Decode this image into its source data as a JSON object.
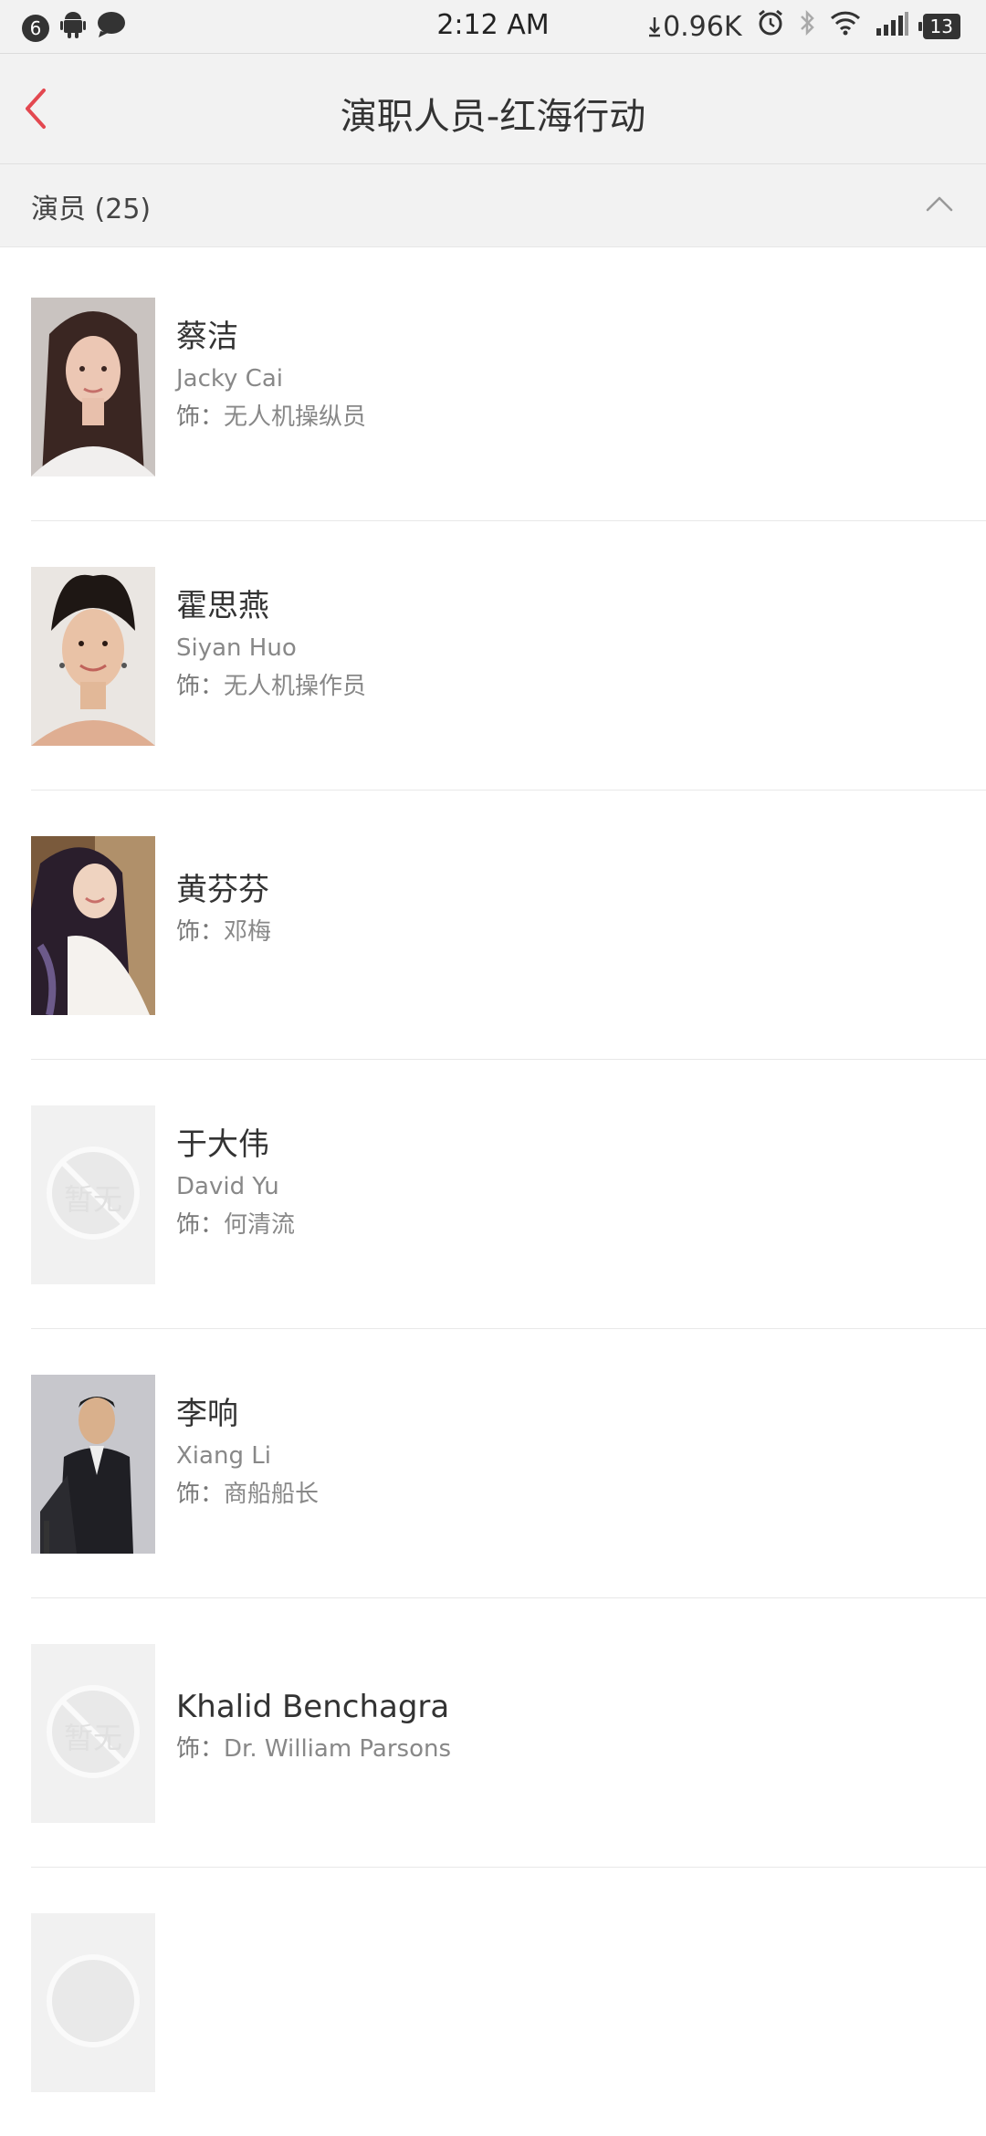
{
  "status_bar": {
    "notification_count": "6",
    "time": "2:12 AM",
    "network_speed": "0.96K",
    "battery": "13",
    "icons": [
      "android-icon",
      "chat-icon",
      "download-arrow-icon",
      "alarm-icon",
      "bluetooth-icon",
      "wifi-icon",
      "signal-icon",
      "battery-icon"
    ]
  },
  "header": {
    "title": "演职人员-红海行动",
    "back_icon": "chevron-left-icon",
    "accent_color": "#e34850"
  },
  "section": {
    "label": "演员 (25)",
    "toggle_icon": "chevron-up-icon"
  },
  "cast": [
    {
      "name": "蔡洁",
      "english_name": "Jacky Cai",
      "role_prefix": "饰：",
      "role": "无人机操纵员",
      "photo": "portrait"
    },
    {
      "name": "霍思燕",
      "english_name": "Siyan Huo",
      "role_prefix": "饰：",
      "role": "无人机操作员",
      "photo": "portrait"
    },
    {
      "name": "黄芬芬",
      "english_name": "",
      "role_prefix": "饰：",
      "role": "邓梅",
      "photo": "portrait"
    },
    {
      "name": "于大伟",
      "english_name": "David Yu",
      "role_prefix": "饰：",
      "role": "何清流",
      "photo": "placeholder",
      "placeholder_text": "暂无"
    },
    {
      "name": "李响",
      "english_name": "Xiang Li",
      "role_prefix": "饰：",
      "role": "商船船长",
      "photo": "portrait"
    },
    {
      "name": "Khalid Benchagra",
      "english_name": "",
      "role_prefix": "饰：",
      "role": "Dr. William Parsons",
      "photo": "placeholder",
      "placeholder_text": "暂无"
    },
    {
      "name": "",
      "english_name": "",
      "role_prefix": "",
      "role": "",
      "photo": "placeholder",
      "placeholder_text": ""
    }
  ]
}
